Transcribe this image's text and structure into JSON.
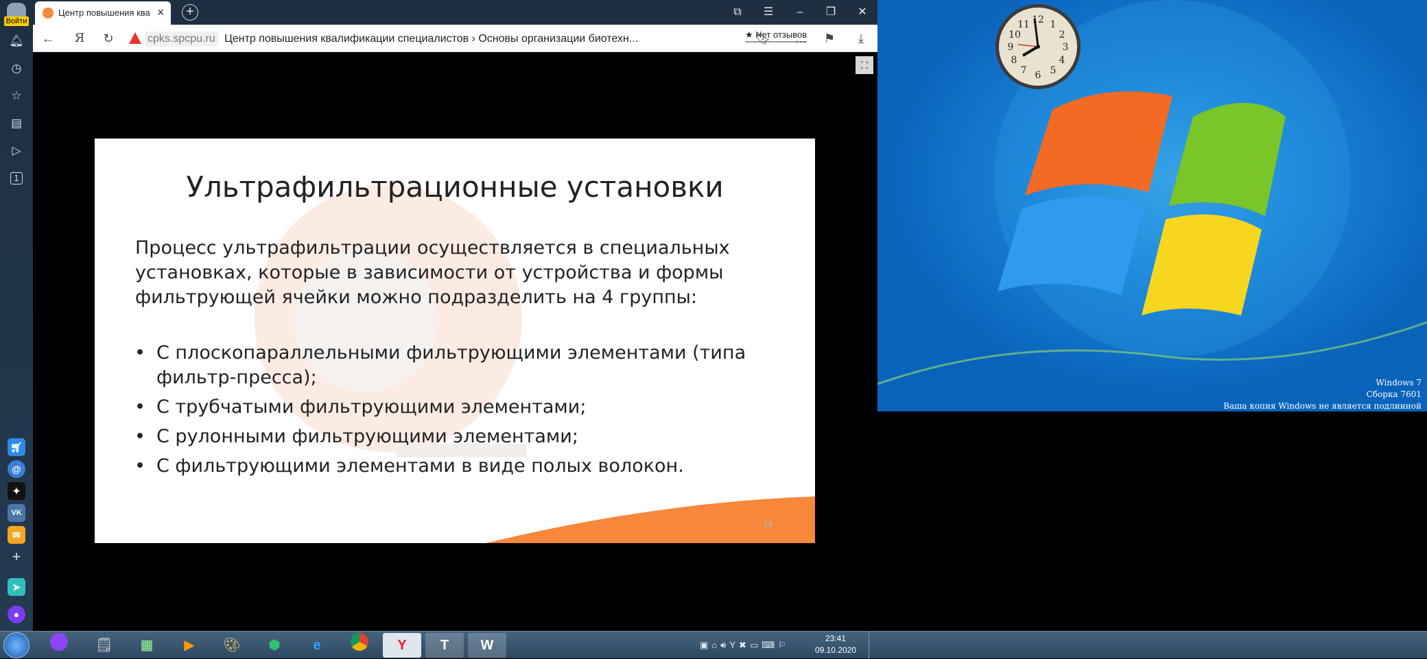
{
  "yandex_sidebar": {
    "login_label": "Войти"
  },
  "browser": {
    "tab": {
      "title": "Центр повышения ква"
    },
    "address": {
      "domain": "cpks.spcpu.ru",
      "page_title": "Центр повышения квалификации специалистов › Основы организации биотехн...",
      "reviews_badge": "★ Нет отзывов",
      "yandex_glyph": "Я"
    }
  },
  "slide": {
    "title": "Ультрафильтрационные установки",
    "intro": "Процесс ультрафильтрации осуществляется в специальных установках, которые в зависимости от устройства и формы фильтрующей ячейки можно подразделить на 4 группы:",
    "bullets": [
      "С плоскопараллельными фильтрующими элементами (типа фильтр-пресса);",
      "С трубчатыми фильтрующими элементами;",
      "С рулонными фильтрующими элементами;",
      "С фильтрующими элементами в виде полых волокон."
    ],
    "page_number": "19",
    "accent_color": "#f7873a"
  },
  "desktop": {
    "watermark": [
      "Windows 7",
      "Сборка 7601",
      "Ваша копия Windows не является подлинной"
    ]
  },
  "clock": {
    "numbers": [
      "12",
      "1",
      "2",
      "3",
      "4",
      "5",
      "6",
      "7",
      "8",
      "9",
      "10",
      "11"
    ]
  },
  "taskbar": {
    "time": "23:41",
    "date": "09.10.2020"
  }
}
